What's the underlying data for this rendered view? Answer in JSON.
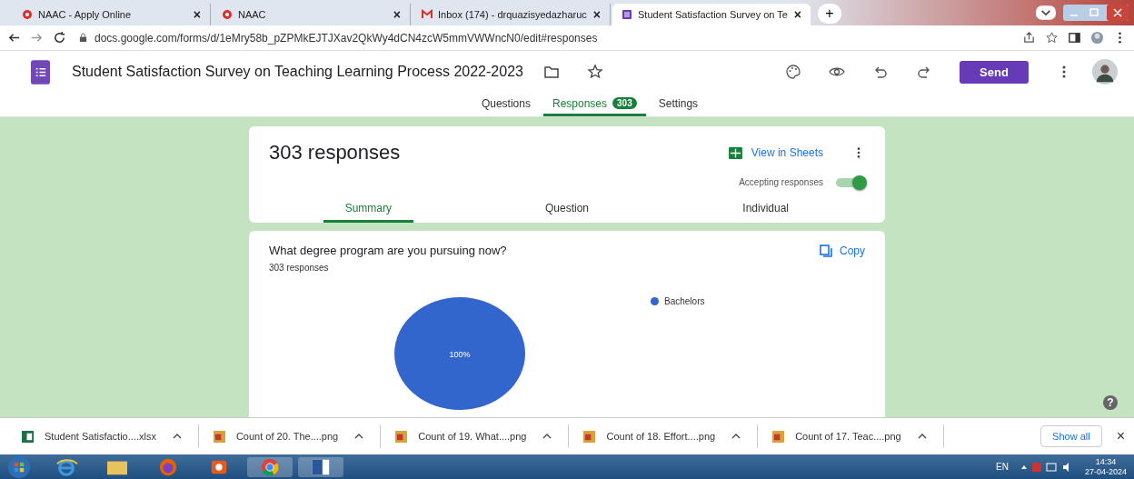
{
  "browser_tabs": [
    {
      "title": "NAAC - Apply Online",
      "kind": "naac",
      "selected": false,
      "close": "×"
    },
    {
      "title": "NAAC",
      "kind": "naac",
      "selected": false,
      "close": "×"
    },
    {
      "title": "Inbox (174) - drquazisyedazharuc",
      "kind": "mail",
      "selected": false,
      "close": "×"
    },
    {
      "title": "Student Satisfaction Survey on Te",
      "kind": "forms",
      "selected": true,
      "close": "×"
    }
  ],
  "new_tab": "+",
  "address": "docs.google.com/forms/d/1eMry58b_pZPMkEJTJXav2QkWy4dCN4zcW5mmVWWncN0/edit#responses",
  "form_title": "Student Satisfaction Survey on Teaching Learning Process 2022-2023",
  "send_button": "Send",
  "form_tabs": [
    {
      "label": "Questions",
      "selected": false
    },
    {
      "label": "Responses",
      "selected": true,
      "badge": "303"
    },
    {
      "label": "Settings",
      "selected": false
    }
  ],
  "summary_card": {
    "heading": "303 responses",
    "view_in_sheets": "View in Sheets",
    "accepting_label": "Accepting responses",
    "accepting": true,
    "tabs": [
      {
        "label": "Summary",
        "selected": true
      },
      {
        "label": "Question",
        "selected": false
      },
      {
        "label": "Individual",
        "selected": false
      }
    ]
  },
  "question_card": {
    "question": "What degree program are you pursuing now?",
    "count": "303 responses",
    "copy": "Copy",
    "chart_data": {
      "type": "pie",
      "series": [
        {
          "name": "Bachelors",
          "color": "#3366cc",
          "values": [
            100
          ]
        }
      ],
      "value_labels": [
        "100%"
      ]
    }
  },
  "help": "?",
  "downloads": [
    {
      "name": "Student Satisfactio....xlsx",
      "kind": "xlsx"
    },
    {
      "name": "Count of 20. The....png",
      "kind": "png"
    },
    {
      "name": "Count of 19. What....png",
      "kind": "png"
    },
    {
      "name": "Count of 18. Effort....png",
      "kind": "png"
    },
    {
      "name": "Count of 17. Teac....png",
      "kind": "png"
    }
  ],
  "show_all": "Show all",
  "downloads_close": "×",
  "taskbar": {
    "language": "EN",
    "time": "14:34",
    "date": "27-04-2024"
  }
}
